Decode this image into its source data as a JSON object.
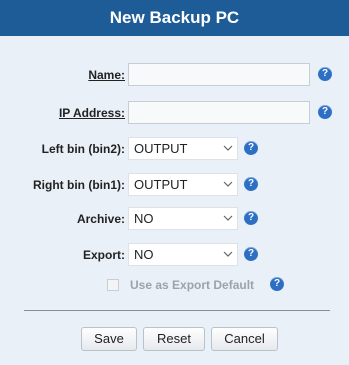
{
  "dialog": {
    "title": "New Backup PC"
  },
  "form": {
    "name": {
      "label": "Name:",
      "value": ""
    },
    "ip": {
      "label": "IP Address:",
      "value": ""
    },
    "left_bin": {
      "label": "Left bin (bin2):",
      "value": "OUTPUT"
    },
    "right_bin": {
      "label": "Right bin (bin1):",
      "value": "OUTPUT"
    },
    "archive": {
      "label": "Archive:",
      "value": "NO"
    },
    "export": {
      "label": "Export:",
      "value": "NO"
    },
    "export_default": {
      "label": "Use as Export Default",
      "checked": false,
      "enabled": false
    }
  },
  "help_glyph": "?",
  "buttons": {
    "save": "Save",
    "reset": "Reset",
    "cancel": "Cancel"
  },
  "icons": {
    "help": "help-icon",
    "chevron": "chevron-down-icon"
  },
  "colors": {
    "title_bg": "#1e5c98",
    "panel_bg": "#eaf0f7",
    "help": "#2d6fc2"
  }
}
